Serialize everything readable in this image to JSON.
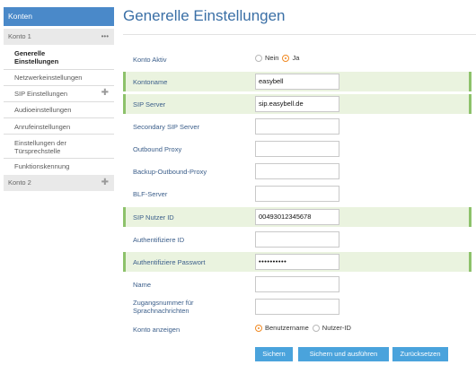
{
  "sidebar": {
    "header": "Konten",
    "account1": {
      "label": "Konto 1",
      "menu_icon": "more-dots-icon"
    },
    "items": [
      {
        "label": "Generelle Einstellungen",
        "active": true
      },
      {
        "label": "Netzwerkeinstellungen"
      },
      {
        "label": "SIP Einstellungen",
        "expandable": true
      },
      {
        "label": "Audioeinstellungen"
      },
      {
        "label": "Anrufeinstellungen"
      },
      {
        "label": "Einstellungen der Türsprechstelle"
      },
      {
        "label": "Funktionskennung"
      }
    ],
    "account2": {
      "label": "Konto 2",
      "expand_icon": "plus-icon"
    }
  },
  "page": {
    "title": "Generelle Einstellungen"
  },
  "form": {
    "konto_aktiv": {
      "label": "Konto Aktiv",
      "options": [
        "Nein",
        "Ja"
      ],
      "selected": "Ja"
    },
    "kontoname": {
      "label": "Kontoname",
      "value": "easybell"
    },
    "sip_server": {
      "label": "SIP Server",
      "value": "sip.easybell.de"
    },
    "secondary_sip_server": {
      "label": "Secondary SIP Server",
      "value": ""
    },
    "outbound_proxy": {
      "label": "Outbound Proxy",
      "value": ""
    },
    "backup_outbound_proxy": {
      "label": "Backup-Outbound-Proxy",
      "value": ""
    },
    "blf_server": {
      "label": "BLF-Server",
      "value": ""
    },
    "sip_nutzer_id": {
      "label": "SIP Nutzer ID",
      "value": "00493012345678"
    },
    "authentifiziere_id": {
      "label": "Authentifiziere ID",
      "value": ""
    },
    "authentifiziere_passwort": {
      "label": "Authentifiziere Passwort",
      "value": "••••••••••"
    },
    "name": {
      "label": "Name",
      "value": ""
    },
    "zugangsnummer": {
      "label": "Zugangsnummer für Sprachnachrichten",
      "value": ""
    },
    "konto_anzeigen": {
      "label": "Konto anzeigen",
      "options": [
        "Benutzername",
        "Nutzer-ID"
      ],
      "selected": "Benutzername"
    }
  },
  "buttons": {
    "save": "Sichern",
    "save_apply": "Sichern und ausführen",
    "reset": "Zurücksetzen"
  },
  "colors": {
    "accent": "#4a89c9",
    "highlight_row": "#eaf3df",
    "highlight_bar": "#8dc26b",
    "radio_selected": "#f08a24",
    "button": "#4aa3dc"
  }
}
